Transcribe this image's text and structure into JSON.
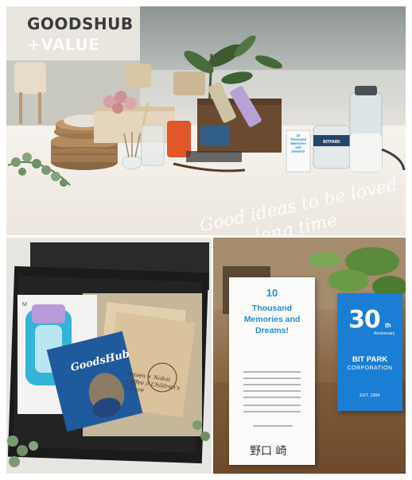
{
  "brand": {
    "line1": "GOODSHUB",
    "line2": "+VALUE"
  },
  "overlay": {
    "cursive_line1": "Good ideas to be loved",
    "cursive_line2": "for a long time"
  },
  "message_card_top": {
    "lines": [
      "10",
      "Thousand",
      "Memories",
      "and",
      "Dreams!"
    ]
  },
  "goodshub_card": {
    "title": "GoodsHub"
  },
  "coffee": {
    "label": "Seisen × Nakai Coffee // Children's Future"
  },
  "message_card": {
    "number": "10",
    "message": "Thousand Memories and Dreams!",
    "signature": "野口 崎"
  },
  "anniversary_card": {
    "number": "30",
    "suffix": "th",
    "word": "Anniversary",
    "company": "BIT PARK",
    "corporation": "CORPORATION",
    "established": "EST. 1994",
    "color": "#1a7fd4"
  },
  "colors": {
    "brand_text": "#3b3b3b",
    "accent_blue": "#1f8ed6",
    "wood": "#7a5535"
  }
}
